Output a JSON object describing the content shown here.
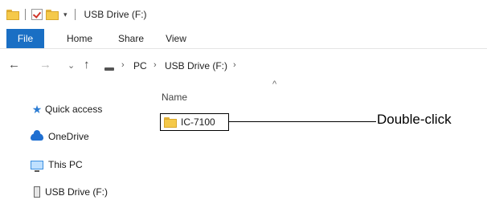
{
  "titlebar": {
    "title": "USB Drive (F:)"
  },
  "ribbon": {
    "tabs": [
      "File",
      "Home",
      "Share",
      "View"
    ]
  },
  "addressbar": {
    "crumbs": [
      "PC",
      "USB Drive (F:)"
    ],
    "separator": "›"
  },
  "filelist": {
    "column_name": "Name",
    "sort_indicator": "^",
    "items": [
      "IC-7100"
    ]
  },
  "sidebar": {
    "items": [
      "Quick access",
      "OneDrive",
      "This PC",
      "USB Drive (F:)"
    ]
  },
  "annotation": {
    "text": "Double-click"
  },
  "colors": {
    "accent": "#1a6fc4",
    "folder": "#f5c94a"
  }
}
